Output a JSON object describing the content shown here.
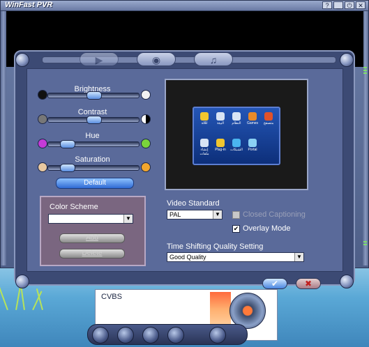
{
  "app": {
    "brand": "WinFast PVR"
  },
  "titlebar": {
    "help": "?",
    "minimize": "_",
    "power": "⏻",
    "close": "✕"
  },
  "sliders": {
    "brightness": {
      "label": "Brightness",
      "level": 0.5
    },
    "contrast": {
      "label": "Contrast",
      "level": 0.5
    },
    "hue": {
      "label": "Hue",
      "level": 0.15
    },
    "saturation": {
      "label": "Saturation",
      "level": 0.15
    }
  },
  "default_button": "Default",
  "color_scheme": {
    "label": "Color Scheme",
    "value": "",
    "add": "Add",
    "delete": "Delete"
  },
  "video_standard": {
    "label": "Video Standard",
    "value": "PAL"
  },
  "closed_captioning": {
    "label": "Closed Captioning",
    "checked": false,
    "enabled": false
  },
  "overlay_mode": {
    "label": "Overlay Mode",
    "checked": true
  },
  "time_shift": {
    "label": "Time Shifting Quality Setting",
    "value": "Good Quality"
  },
  "preview_apps": [
    {
      "name": "ا&لة",
      "color": "#f2c62e"
    },
    {
      "name": "البيئة",
      "color": "#d8e4f4"
    },
    {
      "name": "النظام",
      "color": "#d8e4f4"
    },
    {
      "name": "Games",
      "color": "#e88a2a"
    },
    {
      "name": "متصفح",
      "color": "#e0522a"
    },
    {
      "name": "إنشاء ملفات",
      "color": "#d8e4f4"
    },
    {
      "name": "Plug-in",
      "color": "#f2c62e"
    },
    {
      "name": "الشبكات",
      "color": "#4ab4f0"
    },
    {
      "name": "Portal",
      "color": "#8ad0f4"
    }
  ],
  "widget": {
    "input": "CVBS"
  },
  "icons": {
    "ok": "✔",
    "cancel": "✖"
  }
}
